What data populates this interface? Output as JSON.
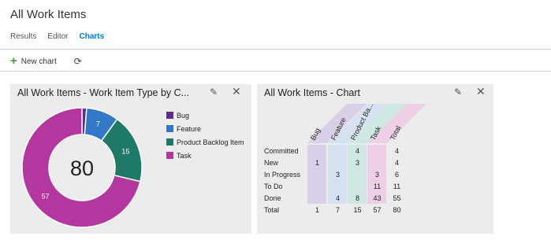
{
  "page": {
    "title": "All Work Items"
  },
  "tabs": [
    {
      "label": "Results"
    },
    {
      "label": "Editor"
    },
    {
      "label": "Charts"
    }
  ],
  "toolbar": {
    "new_chart_label": "New chart",
    "new_chart_icon": "plus-icon",
    "refresh_icon": "refresh-icon"
  },
  "colors": {
    "accent": "#0078d7",
    "bug": "#5c2d91",
    "feature": "#3278c8",
    "pbi": "#1e7a66",
    "task": "#b4369f"
  },
  "chart1": {
    "title": "All Work Items - Work Item Type by C...",
    "total_label": "80",
    "edit_icon": "pencil-icon",
    "close_icon": "close-icon"
  },
  "chart2": {
    "title": "All Work Items - Chart",
    "edit_icon": "pencil-icon",
    "close_icon": "close-icon"
  },
  "chart_data": [
    {
      "type": "pie",
      "title": "All Work Items - Work Item Type by C...",
      "center_label": "80",
      "categories": [
        "Bug",
        "Feature",
        "Product Backlog Item",
        "Task"
      ],
      "values": [
        1,
        7,
        15,
        57
      ],
      "colors": [
        "#5c2d91",
        "#3278c8",
        "#1e7a66",
        "#b4369f"
      ],
      "legend": "right"
    },
    {
      "type": "table",
      "title": "All Work Items - Chart",
      "columns": [
        "Bug",
        "Feature",
        "Product Ba...",
        "Task",
        "Total"
      ],
      "rows": [
        {
          "label": "Committed",
          "values": [
            null,
            null,
            4,
            null,
            4
          ]
        },
        {
          "label": "New",
          "values": [
            1,
            null,
            3,
            null,
            4
          ]
        },
        {
          "label": "In Progress",
          "values": [
            null,
            3,
            null,
            3,
            6
          ]
        },
        {
          "label": "To Do",
          "values": [
            null,
            null,
            null,
            11,
            11
          ]
        },
        {
          "label": "Done",
          "values": [
            null,
            4,
            8,
            43,
            55
          ]
        },
        {
          "label": "Total",
          "values": [
            1,
            7,
            15,
            57,
            80
          ]
        }
      ],
      "column_colors": [
        "#d8cfe8",
        "#d6e2f2",
        "#cfe8e3",
        "#edcfe6"
      ]
    }
  ]
}
